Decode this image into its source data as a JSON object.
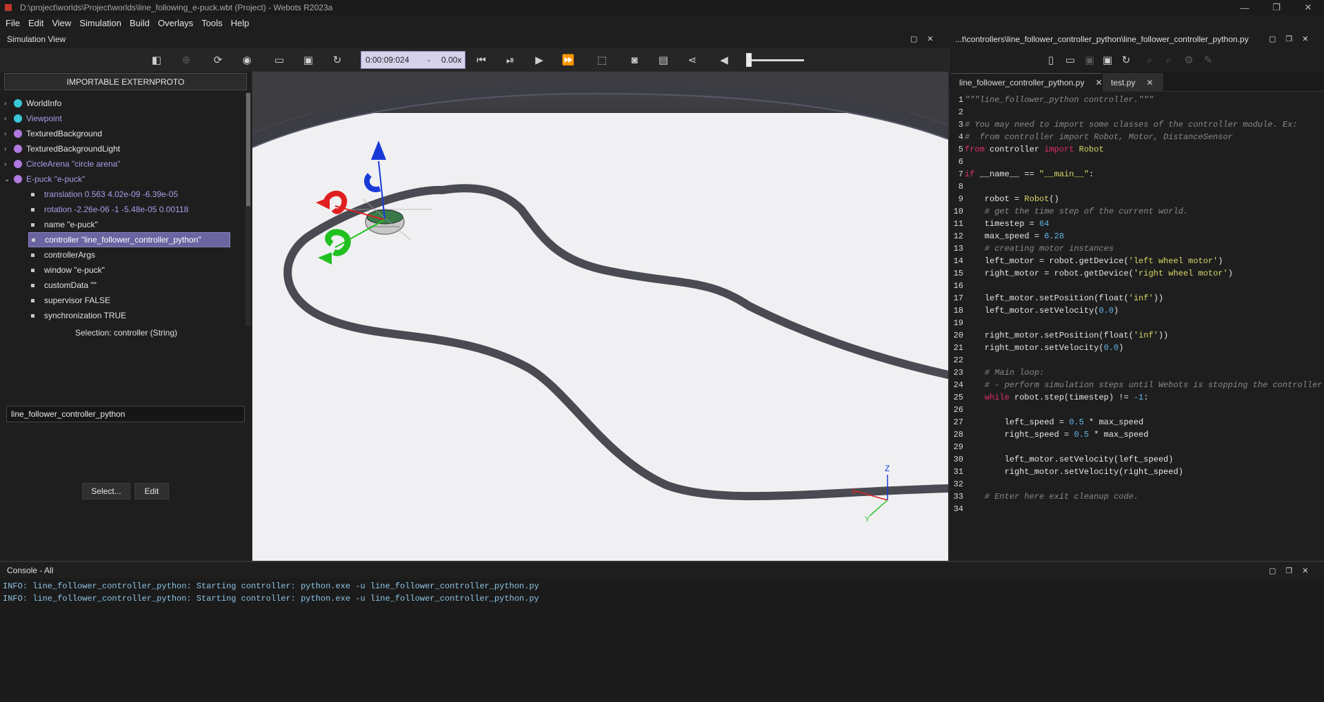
{
  "window": {
    "title": "D:\\project\\worlds\\Project\\worlds\\line_following_e-puck.wbt (Project) - Webots R2023a",
    "controls": [
      "—",
      "❐",
      "✕"
    ]
  },
  "menu": [
    "File",
    "Edit",
    "View",
    "Simulation",
    "Build",
    "Overlays",
    "Tools",
    "Help"
  ],
  "simulation_view": {
    "title": "Simulation View",
    "time": "0:00:09:024",
    "speed_dash": "-",
    "speed": "0.00x"
  },
  "scene_tree": {
    "proto_button": "IMPORTABLE EXTERNPROTO",
    "nodes": [
      {
        "label": "WorldInfo",
        "color": "#38c8d8",
        "expanded": false
      },
      {
        "label": "Viewpoint",
        "color": "#38c8d8",
        "expanded": false
      },
      {
        "label": "TexturedBackground",
        "color": "#b07ae0",
        "expanded": false
      },
      {
        "label": "TexturedBackgroundLight",
        "color": "#b07ae0",
        "expanded": false
      },
      {
        "label": "CircleArena \"circle arena\"",
        "color": "#b07ae0",
        "expanded": false
      },
      {
        "label": "E-puck \"e-puck\"",
        "color": "#b07ae0",
        "expanded": true
      }
    ],
    "fields": [
      {
        "label": "translation 0.563 4.02e-09 -6.39e-05",
        "color": "#a89ee8"
      },
      {
        "label": "rotation -2.26e-06 -1 -5.48e-05 0.00118",
        "color": "#a89ee8"
      },
      {
        "label": "name \"e-puck\"",
        "color": "#e2e2e2"
      },
      {
        "label": "controller \"line_follower_controller_python\"",
        "color": "#ffffff",
        "selected": true
      },
      {
        "label": "controllerArgs",
        "color": "#e2e2e2"
      },
      {
        "label": "window \"e-puck\"",
        "color": "#e2e2e2"
      },
      {
        "label": "customData \"\"",
        "color": "#e2e2e2"
      },
      {
        "label": "supervisor FALSE",
        "color": "#e2e2e2"
      },
      {
        "label": "synchronization TRUE",
        "color": "#e2e2e2"
      }
    ],
    "selection_label": "Selection: controller (String)",
    "field_value": "line_follower_controller_python",
    "select_button": "Select...",
    "edit_button": "Edit"
  },
  "viewport": {
    "axis_labels": {
      "z": "Z",
      "x": "X",
      "y": "Y"
    }
  },
  "editor": {
    "path": "...t\\controllers\\line_follower_controller_python\\line_follower_controller_python.py",
    "tabs": [
      {
        "label": "line_follower_controller_python.py",
        "active": true,
        "close": "✕"
      },
      {
        "label": "test.py",
        "active": false,
        "close": "✕"
      }
    ],
    "colors": {
      "comment": "#8a8a8a",
      "keyword": "#e0306a",
      "string": "#d8d86a",
      "number": "#62b6e8",
      "default": "#e8e8e8"
    },
    "lines": [
      [
        [
          "\"\"\"line_follower_python controller.\"\"\"",
          "comment"
        ]
      ],
      [],
      [
        [
          "# You may need to import some classes of the controller module. Ex:",
          "comment"
        ]
      ],
      [
        [
          "#  from controller import Robot, Motor, DistanceSensor",
          "comment"
        ]
      ],
      [
        [
          "from",
          "keyword"
        ],
        [
          " controller ",
          "default"
        ],
        [
          "import",
          "keyword"
        ],
        [
          " ",
          "default"
        ],
        [
          "Robot",
          "string"
        ]
      ],
      [],
      [
        [
          "if",
          "keyword"
        ],
        [
          " __name__ == ",
          "default"
        ],
        [
          "\"__main__\"",
          "string"
        ],
        [
          ":",
          "default"
        ]
      ],
      [],
      [
        [
          "    robot = ",
          "default"
        ],
        [
          "Robot",
          "string"
        ],
        [
          "()",
          "default"
        ]
      ],
      [
        [
          "    # get the time step of the current world.",
          "comment"
        ]
      ],
      [
        [
          "    timestep = ",
          "default"
        ],
        [
          "64",
          "number"
        ]
      ],
      [
        [
          "    max_speed = ",
          "default"
        ],
        [
          "6.28",
          "number"
        ]
      ],
      [
        [
          "    # creating motor instances",
          "comment"
        ]
      ],
      [
        [
          "    left_motor = robot.getDevice(",
          "default"
        ],
        [
          "'left wheel motor'",
          "string"
        ],
        [
          ")",
          "default"
        ]
      ],
      [
        [
          "    right_motor = robot.getDevice(",
          "default"
        ],
        [
          "'right wheel motor'",
          "string"
        ],
        [
          ")",
          "default"
        ]
      ],
      [],
      [
        [
          "    left_motor.setPosition(float(",
          "default"
        ],
        [
          "'inf'",
          "string"
        ],
        [
          "))",
          "default"
        ]
      ],
      [
        [
          "    left_motor.setVelocity(",
          "default"
        ],
        [
          "0.0",
          "number"
        ],
        [
          ")",
          "default"
        ]
      ],
      [],
      [
        [
          "    right_motor.setPosition(float(",
          "default"
        ],
        [
          "'inf'",
          "string"
        ],
        [
          "))",
          "default"
        ]
      ],
      [
        [
          "    right_motor.setVelocity(",
          "default"
        ],
        [
          "0.0",
          "number"
        ],
        [
          ")",
          "default"
        ]
      ],
      [],
      [
        [
          "    # Main loop:",
          "comment"
        ]
      ],
      [
        [
          "    # - perform simulation steps until Webots is stopping the controller",
          "comment"
        ]
      ],
      [
        [
          "    ",
          "default"
        ],
        [
          "while",
          "keyword"
        ],
        [
          " robot.step(timestep) != ",
          "default"
        ],
        [
          "-1",
          "number"
        ],
        [
          ":",
          "default"
        ]
      ],
      [],
      [
        [
          "        left_speed = ",
          "default"
        ],
        [
          "0.5",
          "number"
        ],
        [
          " * max_speed",
          "default"
        ]
      ],
      [
        [
          "        right_speed = ",
          "default"
        ],
        [
          "0.5",
          "number"
        ],
        [
          " * max_speed",
          "default"
        ]
      ],
      [],
      [
        [
          "        left_motor.setVelocity(left_speed)",
          "default"
        ]
      ],
      [
        [
          "        right_motor.setVelocity(right_speed)",
          "default"
        ]
      ],
      [],
      [
        [
          "    # Enter here exit cleanup code.",
          "comment"
        ]
      ],
      []
    ]
  },
  "console": {
    "title": "Console - All",
    "lines": [
      "INFO: line_follower_controller_python: Starting controller: python.exe -u line_follower_controller_python.py",
      "INFO: line_follower_controller_python: Starting controller: python.exe -u line_follower_controller_python.py"
    ]
  }
}
